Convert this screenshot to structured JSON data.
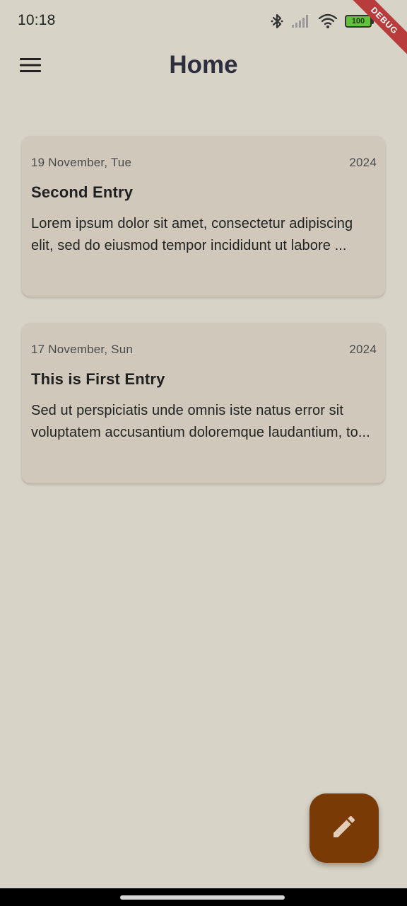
{
  "status_bar": {
    "time": "10:18",
    "battery_level": "100",
    "icons": [
      "bluetooth-icon",
      "signal-icon",
      "wifi-icon",
      "battery-icon"
    ]
  },
  "debug_banner": "DEBUG",
  "app_bar": {
    "title": "Home",
    "menu_icon": "menu-icon"
  },
  "entries": [
    {
      "date": "19 November, Tue",
      "year": "2024",
      "title": "Second Entry",
      "excerpt": "Lorem ipsum dolor sit amet, consectetur adipiscing elit, sed do eiusmod tempor incididunt ut labore ..."
    },
    {
      "date": "17 November, Sun",
      "year": "2024",
      "title": "This is First Entry",
      "excerpt": "Sed ut perspiciatis unde omnis iste natus error sit voluptatem accusantium doloremque laudantium, to..."
    }
  ],
  "fab": {
    "icon": "edit-icon"
  },
  "colors": {
    "background": "#d8d3c7",
    "card": "#d0c9bb",
    "fab": "#7a3a05",
    "title": "#2d2f3f",
    "debug_ribbon": "#b83c3c",
    "battery": "#63c23b"
  }
}
